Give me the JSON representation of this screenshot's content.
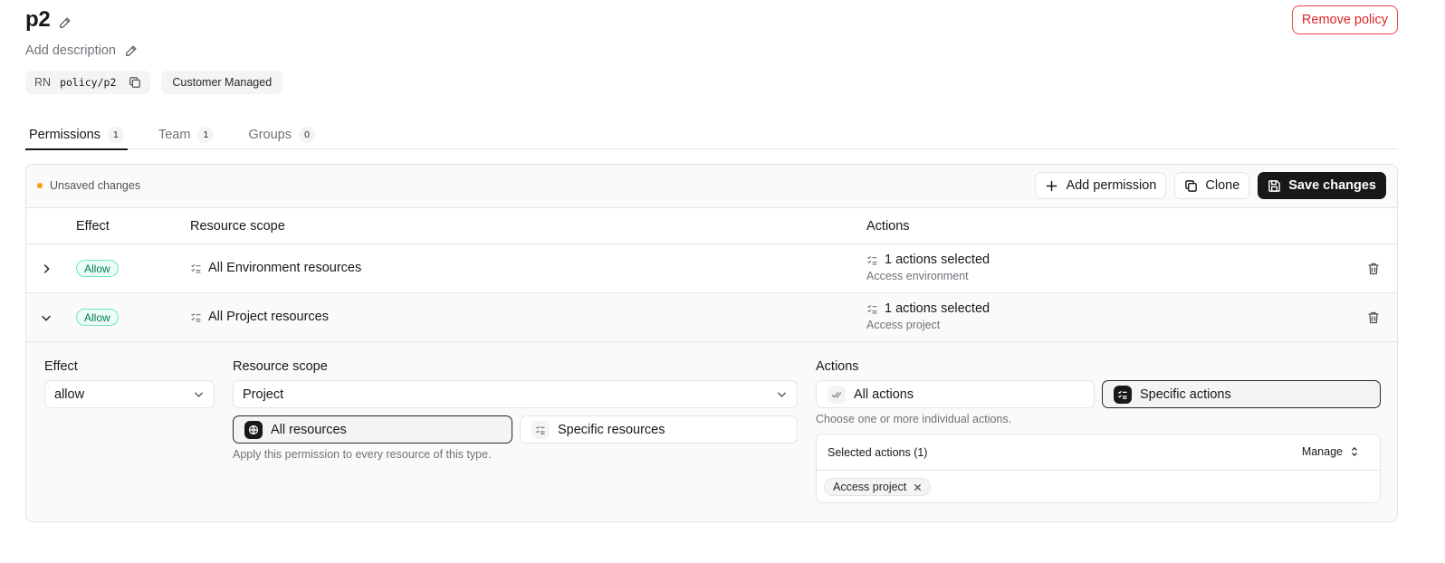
{
  "header": {
    "title": "p2",
    "description_placeholder": "Add description",
    "remove_label": "Remove policy",
    "rn_label": "RN",
    "rn_value": "policy/p2",
    "managed_label": "Customer Managed"
  },
  "tabs": [
    {
      "label": "Permissions",
      "count": "1",
      "active": true
    },
    {
      "label": "Team",
      "count": "1",
      "active": false
    },
    {
      "label": "Groups",
      "count": "0",
      "active": false
    }
  ],
  "toolbar": {
    "unsaved_label": "Unsaved changes",
    "unsaved_color": "#f59e0b",
    "add_label": "Add permission",
    "clone_label": "Clone",
    "save_label": "Save changes"
  },
  "table": {
    "columns": [
      "Effect",
      "Resource scope",
      "Actions"
    ],
    "rows": [
      {
        "effect": "Allow",
        "scope": "All Environment resources",
        "actions": "1 actions selected",
        "actions_detail": "Access environment",
        "expanded": false
      },
      {
        "effect": "Allow",
        "scope": "All Project resources",
        "actions": "1 actions selected",
        "actions_detail": "Access project",
        "expanded": true
      }
    ]
  },
  "editor": {
    "effect_label": "Effect",
    "effect_value": "allow",
    "scope_label": "Resource scope",
    "scope_value": "Project",
    "all_resources_label": "All resources",
    "specific_resources_label": "Specific resources",
    "scope_hint": "Apply this permission to every resource of this type.",
    "actions_label": "Actions",
    "all_actions_label": "All actions",
    "specific_actions_label": "Specific actions",
    "actions_hint": "Choose one or more individual actions.",
    "selected_title": "Selected actions (1)",
    "manage_label": "Manage",
    "selected_tags": [
      "Access project"
    ]
  },
  "colors": {
    "accent_dark": "#18181b",
    "danger": "#dc2626",
    "allow_green": "#047857"
  }
}
